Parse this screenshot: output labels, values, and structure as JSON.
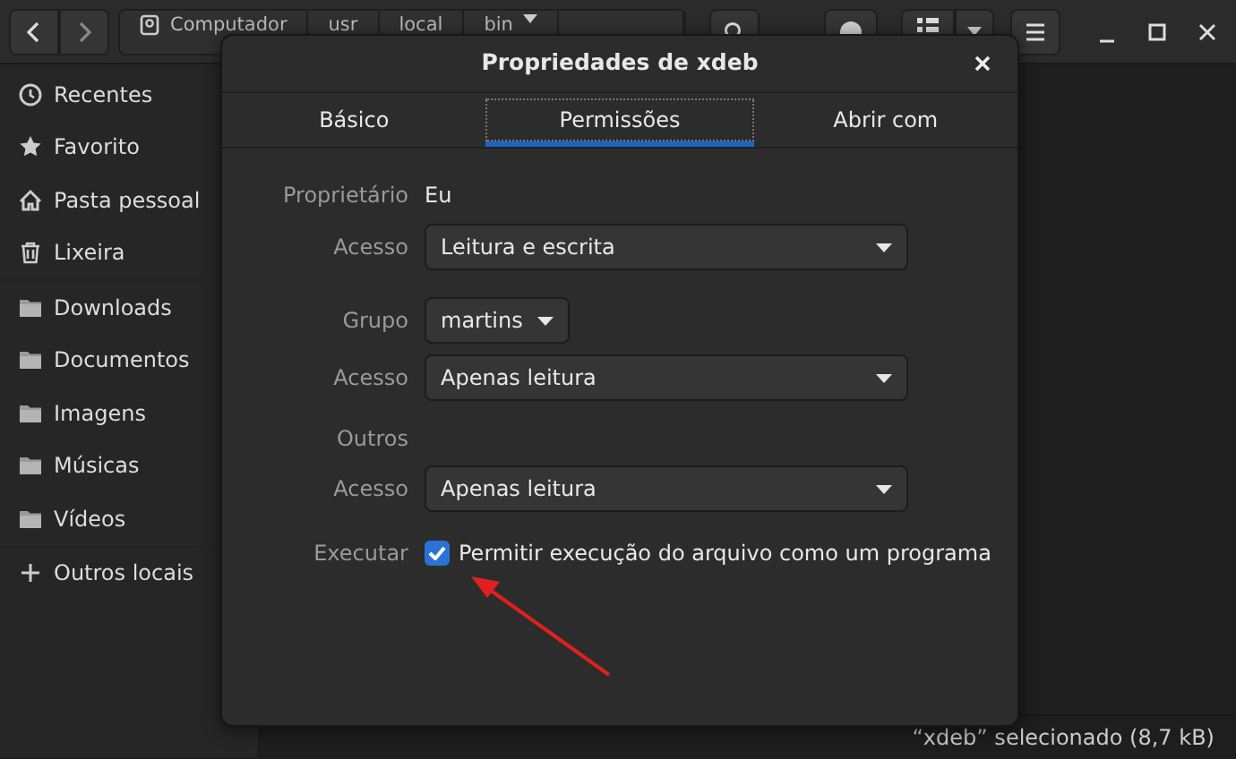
{
  "header": {
    "path": [
      {
        "label": "Computador",
        "kind": "drive"
      },
      {
        "label": "usr",
        "kind": "plain"
      },
      {
        "label": "local",
        "kind": "plain"
      },
      {
        "label": "bin",
        "kind": "caret"
      }
    ]
  },
  "sidebar": {
    "sections": [
      [
        {
          "label": "Recentes",
          "kind": "recent"
        },
        {
          "label": "Favorito",
          "kind": "star"
        },
        {
          "label": "Pasta pessoal",
          "kind": "home"
        },
        {
          "label": "Lixeira",
          "kind": "trash"
        }
      ],
      [
        {
          "label": "Downloads",
          "kind": "folder"
        },
        {
          "label": "Documentos",
          "kind": "folder"
        },
        {
          "label": "Imagens",
          "kind": "folder"
        },
        {
          "label": "Músicas",
          "kind": "folder"
        },
        {
          "label": "Vídeos",
          "kind": "folder"
        }
      ],
      [
        {
          "label": "Outros locais",
          "kind": "plus"
        }
      ]
    ]
  },
  "dialog": {
    "title": "Propriedades de xdeb",
    "tabs": [
      {
        "label": "Básico",
        "selected": false
      },
      {
        "label": "Permissões",
        "selected": true
      },
      {
        "label": "Abrir com",
        "selected": false
      }
    ],
    "rows": [
      {
        "kind": "text",
        "label": "Proprietário",
        "value": "Eu"
      },
      {
        "kind": "dropdown",
        "label": "Acesso",
        "value": "Leitura e escrita"
      },
      {
        "kind": "menubutton",
        "label": "Grupo",
        "value": "martins"
      },
      {
        "kind": "dropdown",
        "label": "Acesso",
        "value": "Apenas leitura"
      },
      {
        "kind": "heading",
        "label": "Outros"
      },
      {
        "kind": "dropdown",
        "label": "Acesso",
        "value": "Apenas leitura"
      },
      {
        "kind": "checkbox",
        "label": "Executar",
        "value": "Permitir execução do arquivo como um programa",
        "checked": true
      }
    ]
  },
  "status_bar": "“xdeb” selecionado (8,7 kB)"
}
